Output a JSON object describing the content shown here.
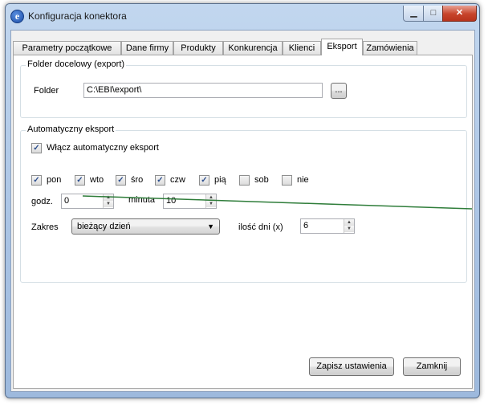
{
  "window": {
    "title": "Konfiguracja konektora",
    "icon_letter": "e"
  },
  "tabs": [
    {
      "label": "Parametry początkowe"
    },
    {
      "label": "Dane firmy"
    },
    {
      "label": "Produkty"
    },
    {
      "label": "Konkurencja"
    },
    {
      "label": "Klienci"
    },
    {
      "label": "Eksport"
    },
    {
      "label": "Zamówienia"
    }
  ],
  "folder_group": {
    "title": "Folder docelowy (export)",
    "folder_label": "Folder",
    "folder_value": "C:\\EBI\\export\\",
    "browse_label": "..."
  },
  "auto_group": {
    "title": "Automatyczny eksport",
    "enable_label": "Włącz automatyczny eksport",
    "enable_checked": true,
    "days": [
      {
        "label": "pon",
        "checked": true
      },
      {
        "label": "wto",
        "checked": true
      },
      {
        "label": "śro",
        "checked": true
      },
      {
        "label": "czw",
        "checked": true
      },
      {
        "label": "pią",
        "checked": true
      },
      {
        "label": "sob",
        "checked": false
      },
      {
        "label": "nie",
        "checked": false
      }
    ],
    "hour_label": "godz.",
    "hour_value": "0",
    "minute_label": "minuta",
    "minute_value": "10",
    "range_label": "Zakres",
    "range_value": "bieżący dzień",
    "days_count_label": "ilość dni (x)",
    "days_count_value": "6"
  },
  "buttons": {
    "save": "Zapisz ustawienia",
    "close": "Zamknij"
  }
}
